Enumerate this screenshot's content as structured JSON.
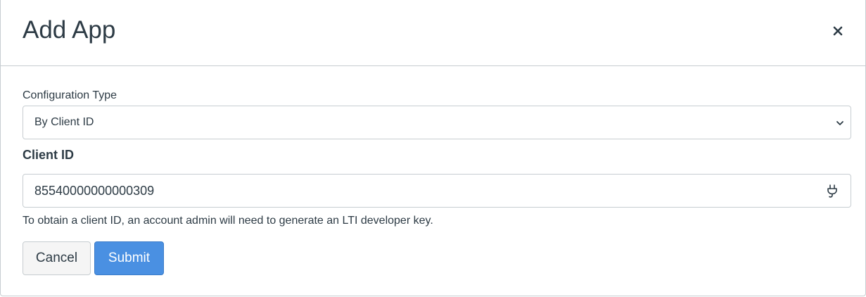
{
  "dialog": {
    "title": "Add App",
    "close_label": "×"
  },
  "form": {
    "configuration_type": {
      "label": "Configuration Type",
      "selected": "By Client ID"
    },
    "client_id": {
      "label": "Client ID",
      "value": "85540000000000309",
      "help_text": "To obtain a client ID, an account admin will need to generate an LTI developer key."
    }
  },
  "actions": {
    "cancel_label": "Cancel",
    "submit_label": "Submit"
  },
  "icons": {
    "close": "close-icon",
    "select_chevron": "chevron-down-icon",
    "input_trailing": "plug-icon"
  },
  "colors": {
    "text": "#2d3b45",
    "border": "#c7cdd1",
    "submit_bg": "#4a90e2",
    "cancel_bg": "#f5f5f5"
  }
}
